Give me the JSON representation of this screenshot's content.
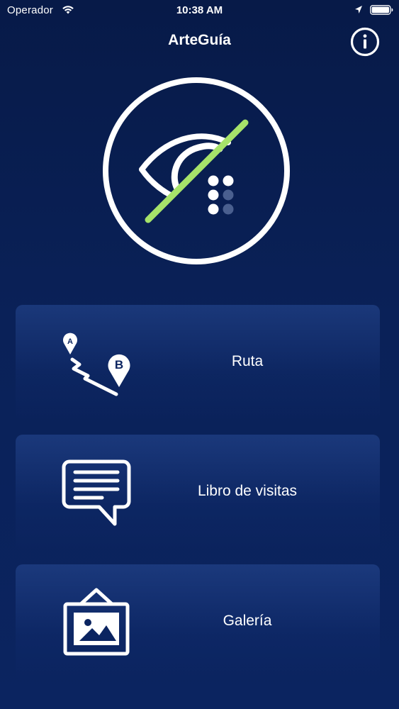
{
  "status_bar": {
    "carrier": "Operador",
    "time": "10:38 AM",
    "icons": [
      "wifi-icon",
      "location-arrow-icon",
      "battery-icon"
    ]
  },
  "nav": {
    "title": "ArteGuía",
    "info_icon": "info-icon"
  },
  "logo": {
    "icon": "eye-braille-slash-icon",
    "colors": {
      "ring": "#ffffff",
      "slash": "#a6e36a",
      "dot_dim": "#4a5f8f"
    }
  },
  "menu": [
    {
      "label": "Ruta",
      "icon": "route-a-to-b-icon"
    },
    {
      "label": "Libro de visitas",
      "icon": "guestbook-speech-bubble-icon"
    },
    {
      "label": "Galería",
      "icon": "gallery-picture-frame-icon"
    }
  ],
  "colors": {
    "background": "#0a1f54",
    "text": "#ffffff",
    "accent": "#a6e36a"
  }
}
